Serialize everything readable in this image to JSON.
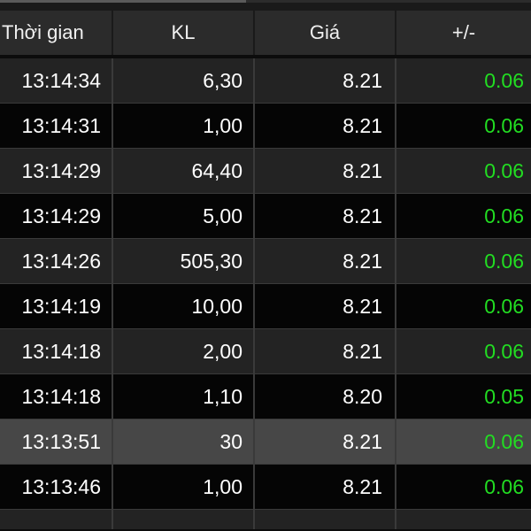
{
  "table": {
    "headers": [
      "Thời gian",
      "KL",
      "Giá",
      "+/-"
    ],
    "rows": [
      {
        "time": "13:14:34",
        "volume": "6,30",
        "price": "8.21",
        "change": "0.06",
        "style": "alt"
      },
      {
        "time": "13:14:31",
        "volume": "1,00",
        "price": "8.21",
        "change": "0.06",
        "style": "norm"
      },
      {
        "time": "13:14:29",
        "volume": "64,40",
        "price": "8.21",
        "change": "0.06",
        "style": "alt"
      },
      {
        "time": "13:14:29",
        "volume": "5,00",
        "price": "8.21",
        "change": "0.06",
        "style": "norm"
      },
      {
        "time": "13:14:26",
        "volume": "505,30",
        "price": "8.21",
        "change": "0.06",
        "style": "alt"
      },
      {
        "time": "13:14:19",
        "volume": "10,00",
        "price": "8.21",
        "change": "0.06",
        "style": "norm"
      },
      {
        "time": "13:14:18",
        "volume": "2,00",
        "price": "8.21",
        "change": "0.06",
        "style": "alt"
      },
      {
        "time": "13:14:18",
        "volume": "1,10",
        "price": "8.20",
        "change": "0.05",
        "style": "norm"
      },
      {
        "time": "13:13:51",
        "volume": "30",
        "price": "8.21",
        "change": "0.06",
        "style": "hl"
      },
      {
        "time": "13:13:46",
        "volume": "1,00",
        "price": "8.21",
        "change": "0.06",
        "style": "norm"
      }
    ]
  },
  "colors": {
    "positive_change": "#22dd22",
    "header_bg": "#2b2b2b",
    "row_alt_bg": "#232323",
    "row_bg": "#050505",
    "row_highlight_bg": "#474747"
  }
}
